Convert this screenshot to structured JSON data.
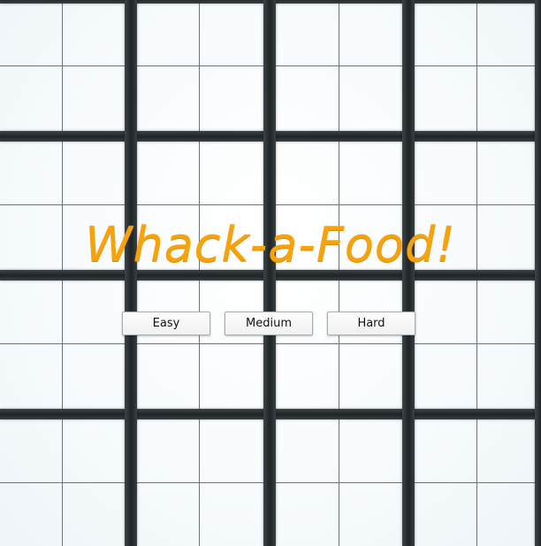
{
  "game": {
    "title": "Whack-a-Food!",
    "title_color": "#f5a20c",
    "grid": {
      "blocks": 4,
      "cells_per_block": 2,
      "divider_color": "#23282b",
      "cell_line_color": "#6c7378"
    }
  },
  "menu": {
    "difficulties": [
      {
        "label": "Easy"
      },
      {
        "label": "Medium"
      },
      {
        "label": "Hard"
      }
    ]
  }
}
